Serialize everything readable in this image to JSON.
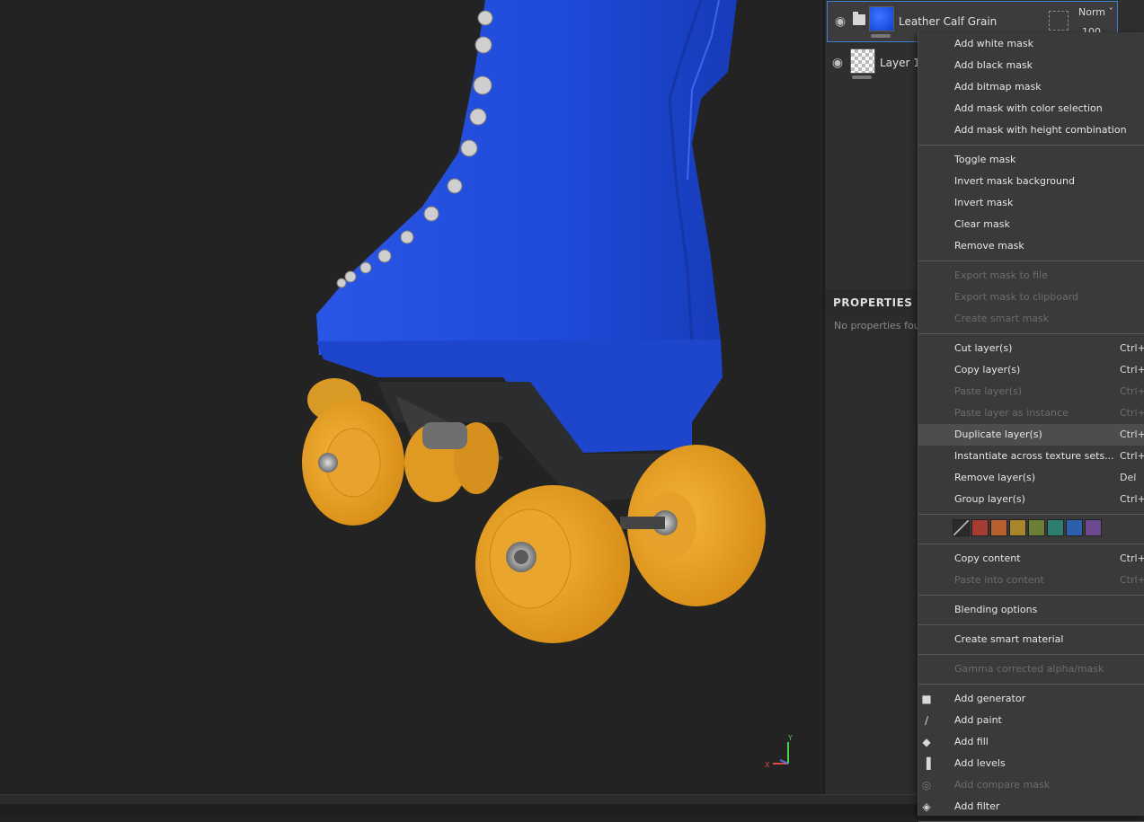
{
  "layers": [
    {
      "name": "Leather Calf Grain",
      "blend_mode": "Norm",
      "opacity": "100",
      "selected": true,
      "thumbnail": "blue-material"
    },
    {
      "name": "Layer 1",
      "selected": false,
      "thumbnail": "transparent-checker"
    }
  ],
  "properties": {
    "title": "PROPERTIES",
    "empty_text": "No properties fou"
  },
  "viewport": {
    "axis_y": "Y",
    "axis_x": "X",
    "colors": {
      "boot": "#1f4fe0",
      "wheels": "#f0a82a",
      "background": "#232323"
    }
  },
  "context_menu": {
    "groups": [
      [
        {
          "label": "Add white mask",
          "enabled": true
        },
        {
          "label": "Add black mask",
          "enabled": true
        },
        {
          "label": "Add bitmap mask",
          "enabled": true
        },
        {
          "label": "Add mask with color selection",
          "enabled": true
        },
        {
          "label": "Add mask with height combination",
          "enabled": true
        }
      ],
      [
        {
          "label": "Toggle mask",
          "enabled": true
        },
        {
          "label": "Invert mask background",
          "enabled": true
        },
        {
          "label": "Invert mask",
          "enabled": true
        },
        {
          "label": "Clear mask",
          "enabled": true
        },
        {
          "label": "Remove mask",
          "enabled": true
        }
      ],
      [
        {
          "label": "Export mask to file",
          "enabled": false
        },
        {
          "label": "Export mask to clipboard",
          "enabled": false
        },
        {
          "label": "Create smart mask",
          "enabled": false
        }
      ],
      [
        {
          "label": "Cut layer(s)",
          "shortcut": "Ctrl+",
          "enabled": true
        },
        {
          "label": "Copy layer(s)",
          "shortcut": "Ctrl+",
          "enabled": true
        },
        {
          "label": "Paste layer(s)",
          "shortcut": "Ctrl+",
          "enabled": false
        },
        {
          "label": "Paste layer as instance",
          "shortcut": "Ctrl+",
          "enabled": false
        },
        {
          "label": "Duplicate layer(s)",
          "shortcut": "Ctrl+",
          "enabled": true,
          "highlighted": true
        },
        {
          "label": "Instantiate across texture sets...",
          "shortcut": "Ctrl+",
          "enabled": true
        },
        {
          "label": "Remove layer(s)",
          "shortcut": "Del",
          "enabled": true
        },
        {
          "label": "Group layer(s)",
          "shortcut": "Ctrl+",
          "enabled": true
        }
      ],
      [
        {
          "label": "Copy content",
          "shortcut": "Ctrl+",
          "enabled": true
        },
        {
          "label": "Paste into content",
          "shortcut": "Ctrl+",
          "enabled": false
        }
      ],
      [
        {
          "label": "Blending options",
          "enabled": true
        }
      ],
      [
        {
          "label": "Create smart material",
          "enabled": true
        }
      ],
      [
        {
          "label": "Gamma corrected alpha/mask",
          "enabled": false
        }
      ],
      [
        {
          "label": "Add generator",
          "icon": "generator-icon",
          "enabled": true
        },
        {
          "label": "Add paint",
          "icon": "brush-icon",
          "enabled": true
        },
        {
          "label": "Add fill",
          "icon": "fill-bucket-icon",
          "enabled": true
        },
        {
          "label": "Add levels",
          "icon": "levels-icon",
          "enabled": true
        },
        {
          "label": "Add compare mask",
          "icon": "compare-mask-icon",
          "enabled": false
        },
        {
          "label": "Add filter",
          "icon": "filter-icon",
          "enabled": true
        }
      ]
    ],
    "color_swatches": [
      "none",
      "#a63c32",
      "#b5622c",
      "#a9862a",
      "#6b7f37",
      "#2e7e6f",
      "#2c5fae",
      "#6d4a8f"
    ]
  }
}
